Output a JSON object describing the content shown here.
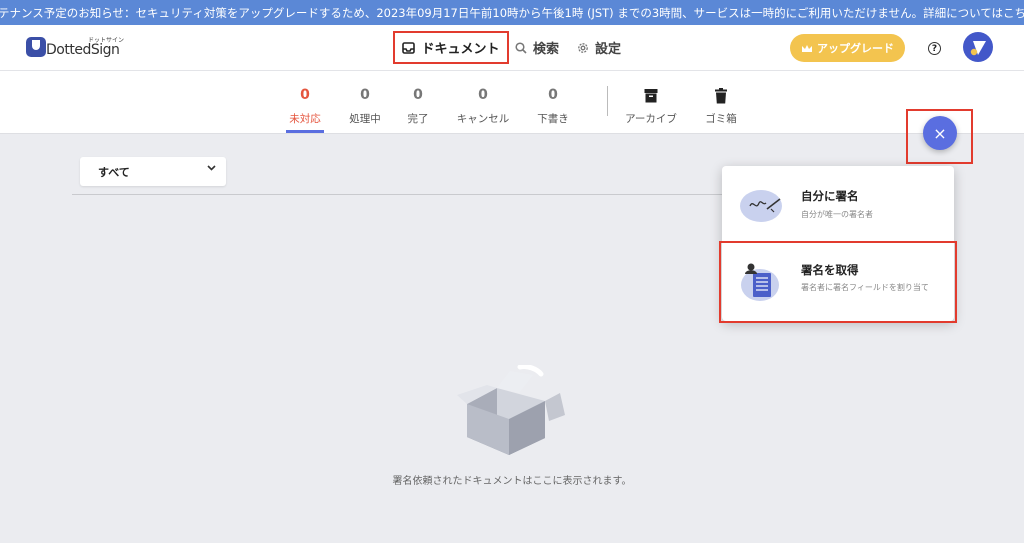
{
  "banner": {
    "text": "メンテナンス予定のお知らせ：セキュリティ対策をアップグレードするため、2023年09月17日午前10時から午後1時 (JST) までの3時間、サービスは一時的にご利用いただけません。詳細についてはこちら。"
  },
  "header": {
    "logo_small": "ドットサイン",
    "logo_text": "DottedSign",
    "nav": {
      "documents": "ドキュメント",
      "search": "検索",
      "settings": "設定"
    },
    "upgrade_label": "アップグレード",
    "help_glyph": "?"
  },
  "tabs": [
    {
      "count": "0",
      "label": "未対応",
      "active": true
    },
    {
      "count": "0",
      "label": "処理中"
    },
    {
      "count": "0",
      "label": "完了"
    },
    {
      "count": "0",
      "label": "キャンセル"
    },
    {
      "count": "0",
      "label": "下書き"
    }
  ],
  "archive_tabs": [
    {
      "label": "アーカイブ",
      "icon": "archive-icon"
    },
    {
      "label": "ゴミ箱",
      "icon": "trash-icon"
    }
  ],
  "filter": {
    "value": "すべて"
  },
  "fab": {
    "glyph": "×"
  },
  "menu": {
    "self_sign": {
      "title": "自分に署名",
      "desc": "自分が唯一の署名者"
    },
    "request_sign": {
      "title": "署名を取得",
      "desc": "署名者に署名フィールドを割り当て"
    }
  },
  "empty_state": {
    "text": "署名依頼されたドキュメントはここに表示されます。"
  },
  "colors": {
    "banner": "#5b88d6",
    "accent": "#5a6ee0",
    "active_tab": "#e5553e",
    "upgrade": "#f3c44f",
    "highlight": "#e23b2e"
  }
}
